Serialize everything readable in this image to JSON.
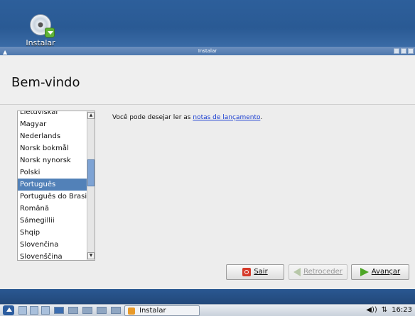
{
  "desktop": {
    "icon_label": "Instalar"
  },
  "window": {
    "title": "Instalar",
    "heading": "Bem-vindo"
  },
  "language_list": {
    "items": [
      "Lietuviškai",
      "Magyar",
      "Nederlands",
      "Norsk bokmål",
      "Norsk nynorsk",
      "Polski",
      "Português",
      "Português do Brasil",
      "Română",
      "Sámegillii",
      "Shqip",
      "Slovenčina",
      "Slovenščina"
    ],
    "selected": "Português"
  },
  "release_note": {
    "prefix": "Você pode desejar ler as ",
    "link": "notas de lançamento",
    "suffix": "."
  },
  "buttons": {
    "quit": "Sair",
    "back": "Retroceder",
    "forward": "Avançar"
  },
  "taskbar": {
    "task_label": "Instalar",
    "clock": "16:23",
    "tray_text": "◀))"
  },
  "colors": {
    "selection": "#5281b8",
    "link": "#1a3ed0",
    "desktop_bg": "#2a5a94"
  }
}
